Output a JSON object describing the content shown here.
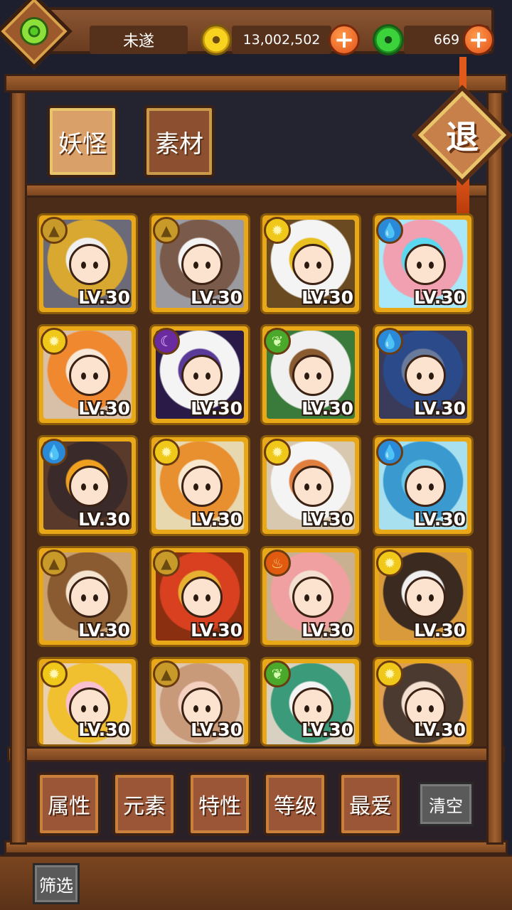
{
  "topbar": {
    "player_name": "未遂",
    "gold_amount": "13,002,502",
    "jade_amount": "669",
    "add_symbol": "+"
  },
  "tabs": [
    {
      "label": "妖怪",
      "active": true
    },
    {
      "label": "素材",
      "active": false
    }
  ],
  "quit_label": "退",
  "monsters": [
    {
      "element": "earth",
      "level": "LV.30",
      "colors": [
        "#f0f0f0",
        "#d8a830",
        "#6a6a78"
      ]
    },
    {
      "element": "earth",
      "level": "LV.30",
      "colors": [
        "#f4f4f4",
        "#7a5a4a",
        "#9a9aa0"
      ]
    },
    {
      "element": "sun",
      "level": "LV.30",
      "colors": [
        "#e8c020",
        "#f4f4f4",
        "#6a4a20"
      ]
    },
    {
      "element": "water",
      "level": "LV.30",
      "colors": [
        "#5ad8f0",
        "#f0a0b0",
        "#a8e8f8"
      ]
    },
    {
      "element": "sun",
      "level": "LV.30",
      "colors": [
        "#f8e8d8",
        "#f08830",
        "#d8c0a8"
      ]
    },
    {
      "element": "moon",
      "level": "LV.30",
      "colors": [
        "#5a3a98",
        "#f4f4f4",
        "#2a1a48"
      ]
    },
    {
      "element": "leaf",
      "level": "LV.30",
      "colors": [
        "#8a5a30",
        "#f0f0f0",
        "#3a7a3a"
      ]
    },
    {
      "element": "water",
      "level": "LV.30",
      "colors": [
        "#6a7a9a",
        "#2a4a8a",
        "#3a3a5a"
      ]
    },
    {
      "element": "water",
      "level": "LV.30",
      "colors": [
        "#f0a020",
        "#3a2a2a",
        "#5a3a2a"
      ]
    },
    {
      "element": "sun",
      "level": "LV.30",
      "colors": [
        "#f8e8d0",
        "#e89030",
        "#e8d8b0"
      ]
    },
    {
      "element": "sun",
      "level": "LV.30",
      "colors": [
        "#e08040",
        "#f4f4f4",
        "#d8c8b0"
      ]
    },
    {
      "element": "water",
      "level": "LV.30",
      "colors": [
        "#6ac8e8",
        "#3a9ad0",
        "#a8e0f0"
      ]
    },
    {
      "element": "earth",
      "level": "LV.30",
      "colors": [
        "#f4e4d0",
        "#8a5a30",
        "#c8a070"
      ]
    },
    {
      "element": "earth",
      "level": "LV.30",
      "colors": [
        "#e8b030",
        "#d84020",
        "#8a3010"
      ]
    },
    {
      "element": "fire",
      "level": "LV.30",
      "colors": [
        "#f4e0d0",
        "#f0a0a0",
        "#c8b090"
      ]
    },
    {
      "element": "sun",
      "level": "LV.30",
      "colors": [
        "#f0f0f0",
        "#3a2a20",
        "#d89a3a"
      ]
    },
    {
      "element": "sun",
      "level": "LV.30",
      "colors": [
        "#f8c0d0",
        "#f0c030",
        "#e8d0b0"
      ]
    },
    {
      "element": "earth",
      "level": "LV.30",
      "colors": [
        "#f4d0c0",
        "#c89a7a",
        "#e0c8b0"
      ]
    },
    {
      "element": "leaf",
      "level": "LV.30",
      "colors": [
        "#f4f4f4",
        "#3a9a7a",
        "#d8d0c0"
      ]
    },
    {
      "element": "sun",
      "level": "LV.30",
      "colors": [
        "#f4e0d0",
        "#4a3a30",
        "#e0a050"
      ]
    }
  ],
  "element_icons": {
    "earth": "▲",
    "sun": "✹",
    "water": "💧",
    "moon": "☾",
    "leaf": "❦",
    "fire": "♨"
  },
  "filters": [
    {
      "label": "属性"
    },
    {
      "label": "元素"
    },
    {
      "label": "特性"
    },
    {
      "label": "等级"
    },
    {
      "label": "最爱"
    }
  ],
  "clear_label": "清空",
  "filter_label": "筛选"
}
